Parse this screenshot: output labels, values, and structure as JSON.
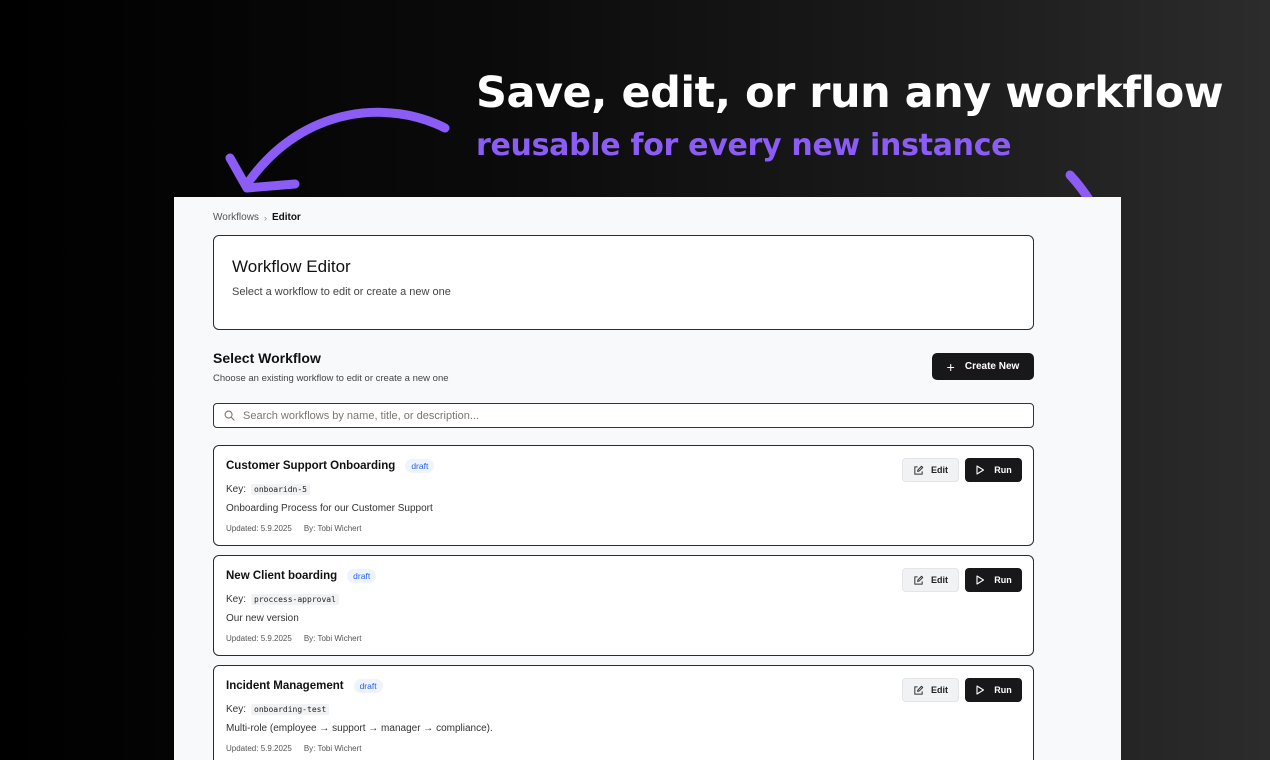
{
  "headline": "Save, edit, or run any workflow",
  "subheadline": "reusable for every new instance",
  "colors": {
    "accent": "#8b5cf6",
    "dark_button": "#18181b",
    "badge_text": "#2563eb",
    "badge_bg": "#eef3fe"
  },
  "breadcrumb": {
    "root": "Workflows",
    "separator": "›",
    "current": "Editor"
  },
  "editor": {
    "title": "Workflow Editor",
    "description": "Select a workflow to edit or create a new one"
  },
  "select_section": {
    "title": "Select Workflow",
    "description": "Choose an existing workflow to edit or create a new one",
    "create_label": "Create New",
    "create_icon": "plus-icon"
  },
  "search": {
    "placeholder": "Search workflows by name, title, or description...",
    "value": "",
    "icon": "search-icon"
  },
  "actions": {
    "edit_label": "Edit",
    "edit_icon": "pencil-square-icon",
    "run_label": "Run",
    "run_icon": "play-icon"
  },
  "workflows": [
    {
      "name": "Customer Support Onboarding",
      "status": "draft",
      "key_label": "Key:",
      "key": "onboaridn-5",
      "description": "Onboarding Process for our Customer Support",
      "updated": "Updated: 5.9.2025",
      "by": "By: Tobi Wichert"
    },
    {
      "name": "New Client boarding",
      "status": "draft",
      "key_label": "Key:",
      "key": "proccess-approval",
      "description": "Our new version",
      "updated": "Updated: 5.9.2025",
      "by": "By: Tobi Wichert"
    },
    {
      "name": "Incident Management",
      "status": "draft",
      "key_label": "Key:",
      "key": "onboarding-test",
      "description": "Multi-role (employee → support → manager → compliance).",
      "updated": "Updated: 5.9.2025",
      "by": "By: Tobi Wichert"
    }
  ]
}
